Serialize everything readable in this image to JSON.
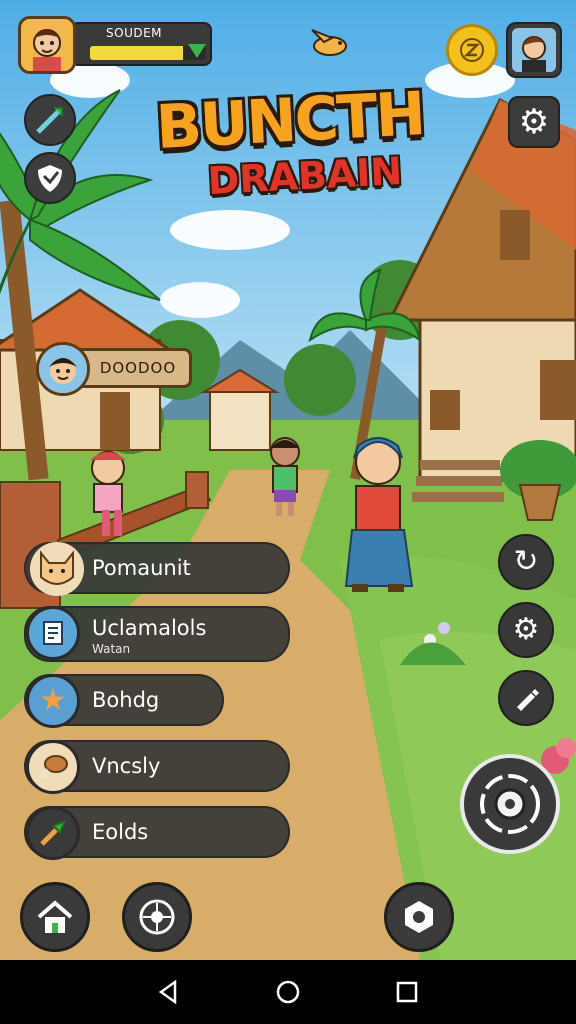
{
  "player": {
    "name": "SOUDEM",
    "xp_progress": 0.8
  },
  "title": {
    "line1": "BUNCTH",
    "line2": "DRABAIN"
  },
  "npc": {
    "plate_text": "DOODOO"
  },
  "menu": [
    {
      "label": "Pomaunit",
      "sub": "",
      "icon": "cat-face-icon",
      "icon_bg": "#f0dcb8"
    },
    {
      "label": "Uclamalols",
      "sub": "Watan",
      "icon": "book-icon",
      "icon_bg": "#5aa6d8"
    },
    {
      "label": "Bohdg",
      "sub": "",
      "icon": "star-icon",
      "icon_bg": "#5a9fd4"
    },
    {
      "label": "Vncsly",
      "sub": "",
      "icon": "drumstick-icon",
      "icon_bg": "#f0dcb8"
    },
    {
      "label": "Eolds",
      "sub": "",
      "icon": "shovel-icon",
      "icon_bg": "#3a3a3a"
    }
  ],
  "right_tools": [
    "refresh-icon",
    "gear-icon",
    "pencil-icon"
  ],
  "bottom_left": [
    "home-icon",
    "compass-icon"
  ],
  "bottom_right": [
    "camera-icon",
    "arrow-go-icon"
  ],
  "colors": {
    "sky": "#79c2ec",
    "grass": "#7fbf4a",
    "path": "#d8ad6a",
    "title_orange": "#f7a31b",
    "title_red": "#e23326",
    "go_green": "#3fbf3a"
  }
}
